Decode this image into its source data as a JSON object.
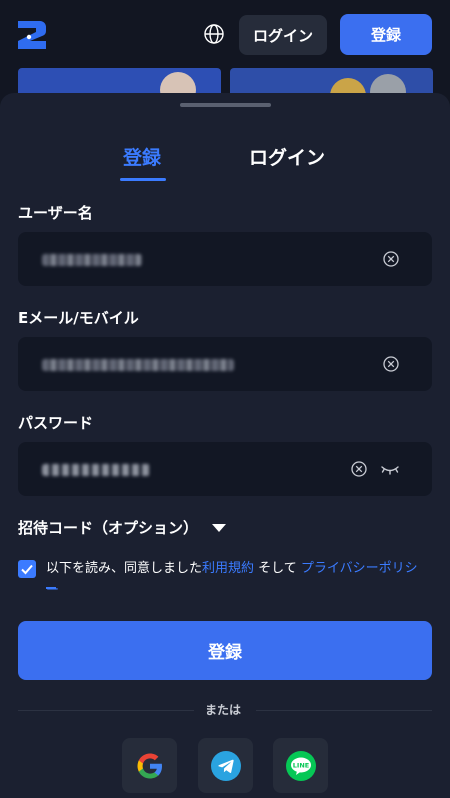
{
  "header": {
    "login_label": "ログイン",
    "register_label": "登録",
    "logo_icon": "brand-logo-icon",
    "language_icon": "globe-icon"
  },
  "tabs": [
    {
      "label": "登録",
      "active": true
    },
    {
      "label": "ログイン",
      "active": false
    }
  ],
  "form": {
    "username_label": "ユーザー名",
    "email_label": "Eメール/モバイル",
    "password_label": "パスワード",
    "referral_label": "招待コード（オプション）",
    "agree_prefix": "以下を読み、同意しました",
    "terms_link": "利用規約",
    "agree_and": " そして ",
    "privacy_link": "プライバシーポリシー",
    "submit_label": "登録",
    "agreed": true
  },
  "divider": {
    "label": "または"
  },
  "social": [
    {
      "name": "google",
      "icon": "google-icon"
    },
    {
      "name": "telegram",
      "icon": "telegram-icon"
    },
    {
      "name": "line",
      "icon": "line-icon",
      "text": "LINE"
    }
  ],
  "colors": {
    "accent": "#3b7bff",
    "button": "#3b6ff0",
    "sheet": "#1b2030",
    "field": "#121724",
    "background": "#121622"
  }
}
